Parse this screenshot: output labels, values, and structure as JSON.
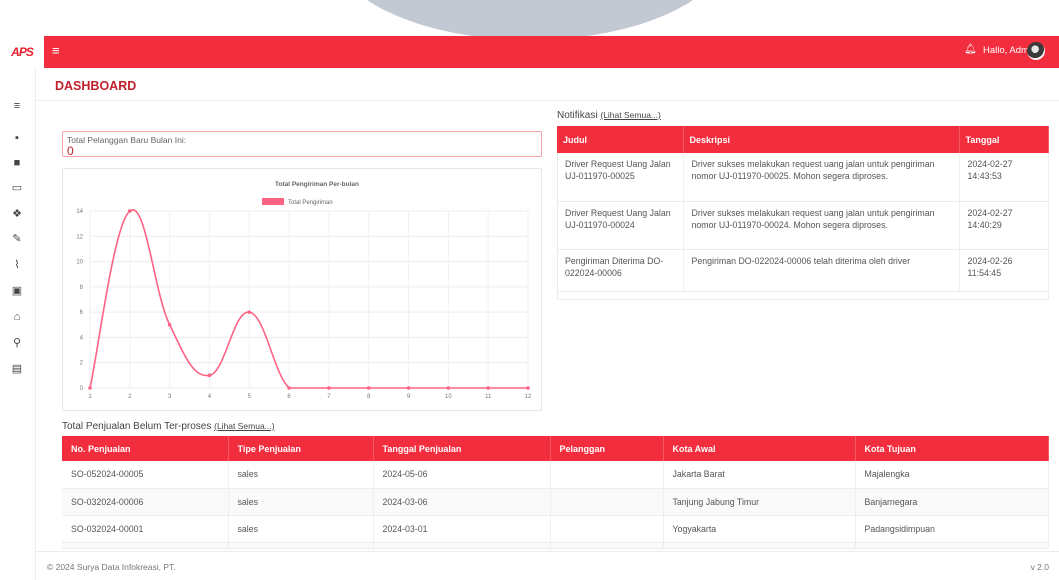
{
  "header": {
    "logo_text": "APS",
    "menu_icon": "hamburger-icon",
    "greeting": "Hallo, Admin",
    "bell_icon": "bell-icon"
  },
  "sidebar": {
    "items": [
      {
        "icon": "menu-icon",
        "glyph": "≡"
      },
      {
        "icon": "printer-icon",
        "glyph": "▪"
      },
      {
        "icon": "truck-icon",
        "glyph": "■"
      },
      {
        "icon": "window-icon",
        "glyph": "▭"
      },
      {
        "icon": "dropbox-icon",
        "glyph": "❖"
      },
      {
        "icon": "wrench-icon",
        "glyph": "✎"
      },
      {
        "icon": "chart-line-icon",
        "glyph": "⌇"
      },
      {
        "icon": "money-icon",
        "glyph": "▣"
      },
      {
        "icon": "bank-icon",
        "glyph": "⌂"
      },
      {
        "icon": "user-plus-icon",
        "glyph": "⚲"
      },
      {
        "icon": "desktop-icon",
        "glyph": "▤"
      }
    ]
  },
  "page": {
    "title": "DASHBOARD"
  },
  "pelanggan": {
    "label": "Total Pelanggan Baru Bulan Ini:",
    "value": "0"
  },
  "chart_data": {
    "type": "line",
    "title": "Total Pengiriman Per-bulan",
    "x": [
      1,
      2,
      3,
      4,
      5,
      6,
      7,
      8,
      9,
      10,
      11,
      12
    ],
    "series": [
      {
        "name": "Total Pengiriman",
        "values": [
          0,
          14,
          5,
          1,
          6,
          0,
          0,
          0,
          0,
          0,
          0,
          0
        ]
      }
    ],
    "ylim": [
      0,
      14
    ],
    "yticks": [
      0,
      2,
      4,
      6,
      8,
      10,
      12,
      14
    ],
    "grid": true,
    "legend": "top",
    "color": "#ff6384"
  },
  "notifikasi": {
    "title": "Notifikasi",
    "link": "(Lihat Semua...)",
    "headers": [
      "Judul",
      "Deskripsi",
      "Tanggal"
    ],
    "rows": [
      {
        "judul": "Driver Request Uang Jalan UJ-011970-00025",
        "deskripsi": "Driver sukses melakukan request uang jalan untuk pengiriman nomor UJ-011970-00025. Mohon segera diproses.",
        "tanggal": "2024-02-27 14:43:53"
      },
      {
        "judul": "Driver Request Uang Jalan UJ-011970-00024",
        "deskripsi": "Driver sukses melakukan request uang jalan untuk pengiriman nomor UJ-011970-00024. Mohon segera diproses.",
        "tanggal": "2024-02-27 14:40:29"
      },
      {
        "judul": "Pengiriman Diterima DO-022024-00006",
        "deskripsi": "Pengiriman DO-022024-00006 telah diterima oleh driver",
        "tanggal": "2024-02-26 11:54:45"
      }
    ]
  },
  "penjualan": {
    "title": "Total Penjualan Belum Ter-proses",
    "link": "(Lihat Semua...)",
    "headers": [
      "No. Penjualan",
      "Tipe Penjualan",
      "Tanggal Penjualan",
      "Pelanggan",
      "Kota Awal",
      "Kota Tujuan"
    ],
    "rows": [
      [
        "SO-052024-00005",
        "sales",
        "2024-05-06",
        "",
        "Jakarta Barat",
        "Majalengka"
      ],
      [
        "SO-032024-00006",
        "sales",
        "2024-03-06",
        "",
        "Tanjung Jabung Timur",
        "Banjarnegara"
      ],
      [
        "SO-032024-00001",
        "sales",
        "2024-03-01",
        "",
        "Yogyakarta",
        "Padangsidimpuan"
      ]
    ]
  },
  "footer": {
    "copyright": "© 2024 Surya Data Infokreasi, PT.",
    "version": "v 2.0"
  },
  "colors": {
    "brand": "#f22d3d",
    "title": "#c0202c"
  }
}
